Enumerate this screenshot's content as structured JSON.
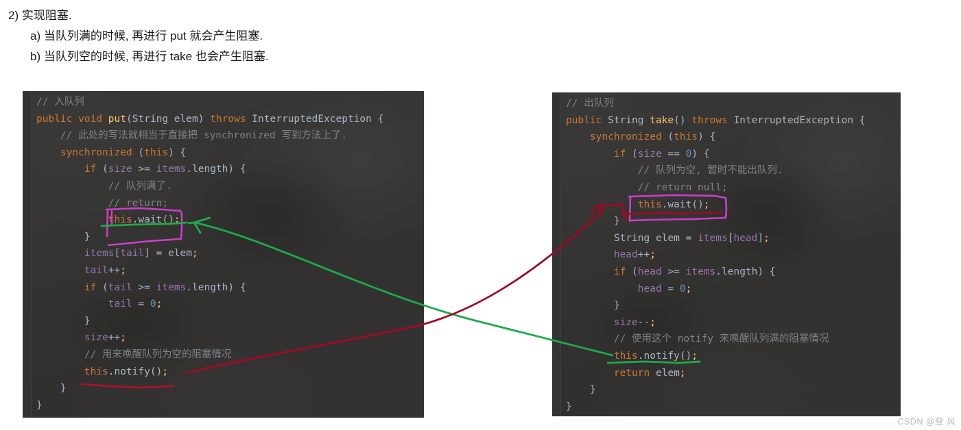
{
  "notes": {
    "lines": [
      {
        "indent": 1,
        "text": "2) 实现阻塞."
      },
      {
        "indent": 2,
        "text": "a) 当队列满的时候, 再进行 put 就会产生阻塞."
      },
      {
        "indent": 2,
        "text": "b) 当队列空的时候, 再进行 take 也会产生阻塞."
      }
    ]
  },
  "panels": {
    "left": {
      "title": "put-method-code",
      "lines": [
        [
          {
            "t": "// 入队列",
            "c": "cm"
          }
        ],
        [
          {
            "t": "public ",
            "c": "kw"
          },
          {
            "t": "void ",
            "c": "kw"
          },
          {
            "t": "put",
            "c": "fn"
          },
          {
            "t": "(String elem) ",
            "c": "pl"
          },
          {
            "t": "throws ",
            "c": "kw"
          },
          {
            "t": "InterruptedException {",
            "c": "pl"
          }
        ],
        [
          {
            "t": "    // 此处的写法就相当于直接把 synchronized 写到方法上了.",
            "c": "cm"
          }
        ],
        [
          {
            "t": "    ",
            "c": "pl"
          },
          {
            "t": "synchronized ",
            "c": "kw"
          },
          {
            "t": "(",
            "c": "pl"
          },
          {
            "t": "this",
            "c": "kw"
          },
          {
            "t": ") {",
            "c": "pl"
          }
        ],
        [
          {
            "t": "        ",
            "c": "pl"
          },
          {
            "t": "if ",
            "c": "kw"
          },
          {
            "t": "(",
            "c": "pl"
          },
          {
            "t": "size",
            "c": "fld"
          },
          {
            "t": " >= ",
            "c": "pl"
          },
          {
            "t": "items",
            "c": "fld"
          },
          {
            "t": ".length) {",
            "c": "pl"
          }
        ],
        [
          {
            "t": "            // 队列满了.",
            "c": "cm"
          }
        ],
        [
          {
            "t": "            // return;",
            "c": "cm"
          }
        ],
        [
          {
            "t": "            ",
            "c": "pl"
          },
          {
            "t": "this",
            "c": "kw"
          },
          {
            "t": ".wait()",
            "c": "pl"
          },
          {
            "t": ";",
            "c": "fn"
          }
        ],
        [
          {
            "t": "        }",
            "c": "pl"
          }
        ],
        [
          {
            "t": "        ",
            "c": "pl"
          },
          {
            "t": "items",
            "c": "fld"
          },
          {
            "t": "[",
            "c": "pl"
          },
          {
            "t": "tail",
            "c": "fld"
          },
          {
            "t": "] = elem",
            "c": "pl"
          },
          {
            "t": ";",
            "c": "fn"
          }
        ],
        [
          {
            "t": "        ",
            "c": "pl"
          },
          {
            "t": "tail",
            "c": "fld"
          },
          {
            "t": "++",
            "c": "pl"
          },
          {
            "t": ";",
            "c": "fn"
          }
        ],
        [
          {
            "t": "        ",
            "c": "pl"
          },
          {
            "t": "if ",
            "c": "kw"
          },
          {
            "t": "(",
            "c": "pl"
          },
          {
            "t": "tail",
            "c": "fld"
          },
          {
            "t": " >= ",
            "c": "pl"
          },
          {
            "t": "items",
            "c": "fld"
          },
          {
            "t": ".length) {",
            "c": "pl"
          }
        ],
        [
          {
            "t": "            ",
            "c": "pl"
          },
          {
            "t": "tail",
            "c": "fld"
          },
          {
            "t": " = ",
            "c": "pl"
          },
          {
            "t": "0",
            "c": "num"
          },
          {
            "t": ";",
            "c": "fn"
          }
        ],
        [
          {
            "t": "        }",
            "c": "pl"
          }
        ],
        [
          {
            "t": "        ",
            "c": "pl"
          },
          {
            "t": "size",
            "c": "fld"
          },
          {
            "t": "++",
            "c": "pl"
          },
          {
            "t": ";",
            "c": "fn"
          }
        ],
        [
          {
            "t": "        // 用来唤醒队列为空的阻塞情况",
            "c": "cm"
          }
        ],
        [
          {
            "t": "        ",
            "c": "pl"
          },
          {
            "t": "this",
            "c": "kw"
          },
          {
            "t": ".notify()",
            "c": "pl"
          },
          {
            "t": ";",
            "c": "fn"
          }
        ],
        [
          {
            "t": "    }",
            "c": "pl"
          }
        ],
        [
          {
            "t": "}",
            "c": "pl"
          }
        ]
      ]
    },
    "right": {
      "title": "take-method-code",
      "lines": [
        [
          {
            "t": "// 出队列",
            "c": "cm"
          }
        ],
        [
          {
            "t": "public ",
            "c": "kw"
          },
          {
            "t": "String ",
            "c": "pl"
          },
          {
            "t": "take",
            "c": "fn"
          },
          {
            "t": "() ",
            "c": "pl"
          },
          {
            "t": "throws ",
            "c": "kw"
          },
          {
            "t": "InterruptedException {",
            "c": "pl"
          }
        ],
        [
          {
            "t": "    ",
            "c": "pl"
          },
          {
            "t": "synchronized ",
            "c": "kw"
          },
          {
            "t": "(",
            "c": "pl"
          },
          {
            "t": "this",
            "c": "kw"
          },
          {
            "t": ") {",
            "c": "pl"
          }
        ],
        [
          {
            "t": "        ",
            "c": "pl"
          },
          {
            "t": "if ",
            "c": "kw"
          },
          {
            "t": "(",
            "c": "pl"
          },
          {
            "t": "size",
            "c": "fld"
          },
          {
            "t": " == ",
            "c": "pl"
          },
          {
            "t": "0",
            "c": "num"
          },
          {
            "t": ") {",
            "c": "pl"
          }
        ],
        [
          {
            "t": "            // 队列为空, 暂时不能出队列.",
            "c": "cm"
          }
        ],
        [
          {
            "t": "            // return null;",
            "c": "cm"
          }
        ],
        [
          {
            "t": "            ",
            "c": "pl"
          },
          {
            "t": "this",
            "c": "kw"
          },
          {
            "t": ".wait()",
            "c": "pl"
          },
          {
            "t": ";",
            "c": "fn"
          }
        ],
        [
          {
            "t": "        }",
            "c": "pl"
          }
        ],
        [
          {
            "t": "        ",
            "c": "pl"
          },
          {
            "t": "String elem = ",
            "c": "pl"
          },
          {
            "t": "items",
            "c": "fld"
          },
          {
            "t": "[",
            "c": "pl"
          },
          {
            "t": "head",
            "c": "fld"
          },
          {
            "t": "]",
            "c": "pl"
          },
          {
            "t": ";",
            "c": "fn"
          }
        ],
        [
          {
            "t": "        ",
            "c": "pl"
          },
          {
            "t": "head",
            "c": "fld"
          },
          {
            "t": "++",
            "c": "pl"
          },
          {
            "t": ";",
            "c": "fn"
          }
        ],
        [
          {
            "t": "        ",
            "c": "pl"
          },
          {
            "t": "if ",
            "c": "kw"
          },
          {
            "t": "(",
            "c": "pl"
          },
          {
            "t": "head",
            "c": "fld"
          },
          {
            "t": " >= ",
            "c": "pl"
          },
          {
            "t": "items",
            "c": "fld"
          },
          {
            "t": ".length) {",
            "c": "pl"
          }
        ],
        [
          {
            "t": "            ",
            "c": "pl"
          },
          {
            "t": "head",
            "c": "fld"
          },
          {
            "t": " = ",
            "c": "pl"
          },
          {
            "t": "0",
            "c": "num"
          },
          {
            "t": ";",
            "c": "fn"
          }
        ],
        [
          {
            "t": "        }",
            "c": "pl"
          }
        ],
        [
          {
            "t": "        ",
            "c": "pl"
          },
          {
            "t": "size",
            "c": "fld"
          },
          {
            "t": "--",
            "c": "pl"
          },
          {
            "t": ";",
            "c": "fn"
          }
        ],
        [
          {
            "t": "        // 使用这个 notify 来唤醒队列满的阻塞情况",
            "c": "cm"
          }
        ],
        [
          {
            "t": "        ",
            "c": "pl"
          },
          {
            "t": "this",
            "c": "kw"
          },
          {
            "t": ".notify()",
            "c": "pl"
          },
          {
            "t": ";",
            "c": "fn"
          }
        ],
        [
          {
            "t": "        ",
            "c": "pl"
          },
          {
            "t": "return ",
            "c": "kw"
          },
          {
            "t": "elem",
            "c": "pl"
          },
          {
            "t": ";",
            "c": "fn"
          }
        ],
        [
          {
            "t": "    }",
            "c": "pl"
          }
        ],
        [
          {
            "t": "}",
            "c": "pl"
          }
        ]
      ]
    }
  },
  "annotations": {
    "colors": {
      "magenta": "#cc3fcc",
      "green": "#1eaa4a",
      "red": "#b50d2b",
      "dark_red": "#a00a24"
    },
    "items": [
      {
        "name": "magenta-box-put-wait",
        "color": "#cc3fcc"
      },
      {
        "name": "magenta-box-take-wait",
        "color": "#cc3fcc"
      },
      {
        "name": "green-underline-put-wait",
        "color": "#1eaa4a"
      },
      {
        "name": "green-underline-take-notify",
        "color": "#1eaa4a"
      },
      {
        "name": "green-arrow-notify-to-wait",
        "color": "#1eaa4a"
      },
      {
        "name": "red-underline-put-notify",
        "color": "#b50d2b"
      },
      {
        "name": "red-arrow-notify-to-wait",
        "color": "#a00a24"
      }
    ]
  },
  "watermark": {
    "text": "CSDN @登 风"
  }
}
